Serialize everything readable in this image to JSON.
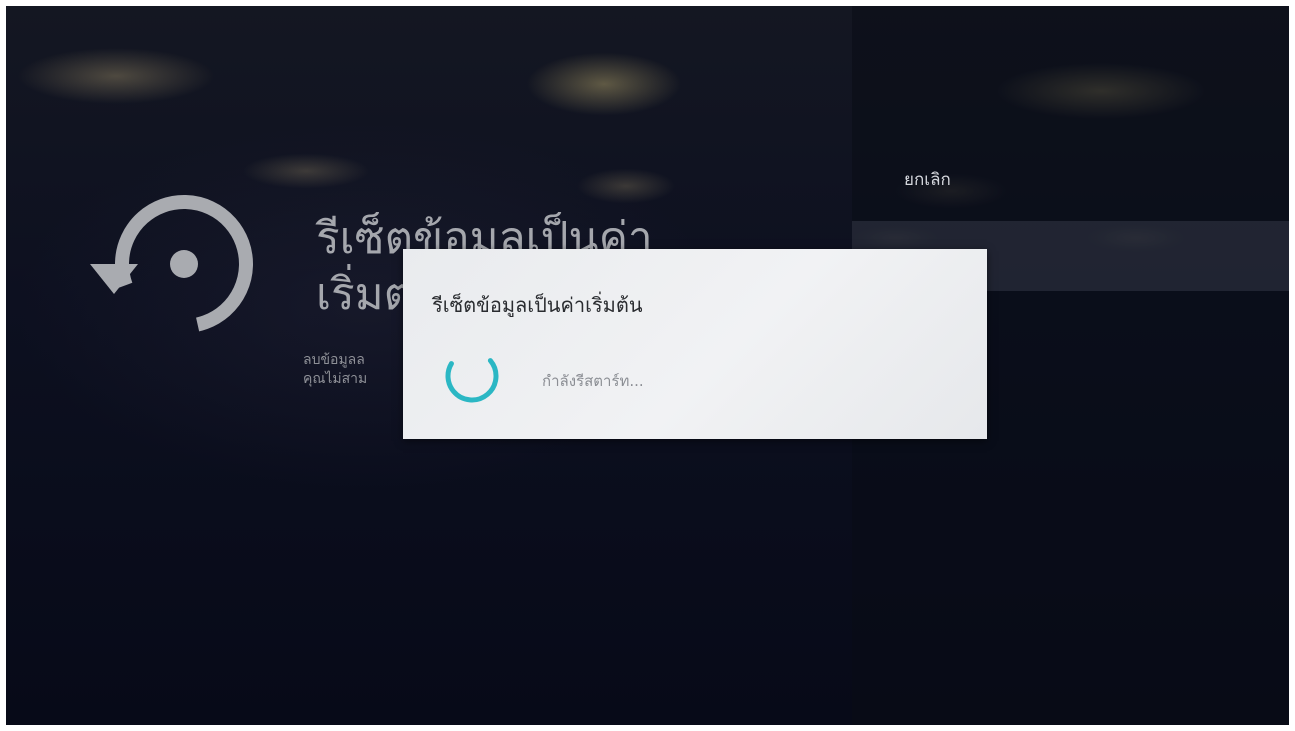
{
  "menu": {
    "cancel_label": "ยกเลิก",
    "ok_label_partial": "ง"
  },
  "background_page": {
    "title": "รีเซ็ตข้อมูลเป็นค่า\nเริ่มต",
    "description": "ลบข้อมูลล\nคุณไม่สาม",
    "icon": "reset-icon"
  },
  "dialog": {
    "title": "รีเซ็ตข้อมูลเป็นค่าเริ่มต้น",
    "status": "กำลังรีสตาร์ท...",
    "spinner_color": "#2bb7c4"
  }
}
